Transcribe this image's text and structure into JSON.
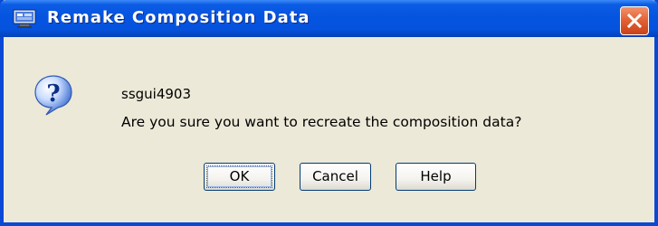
{
  "window": {
    "title": "Remake Composition Data",
    "icon": "app-window-icon",
    "close_icon": "close-icon"
  },
  "message": {
    "icon": "question-icon",
    "id": "ssgui4903",
    "text": "Are you sure you want to recreate the composition data?"
  },
  "buttons": {
    "ok": "OK",
    "cancel": "Cancel",
    "help": "Help"
  },
  "colors": {
    "titlebar": "#0554e0",
    "dialog_background": "#ece9d8",
    "close_button": "#e35f33"
  }
}
